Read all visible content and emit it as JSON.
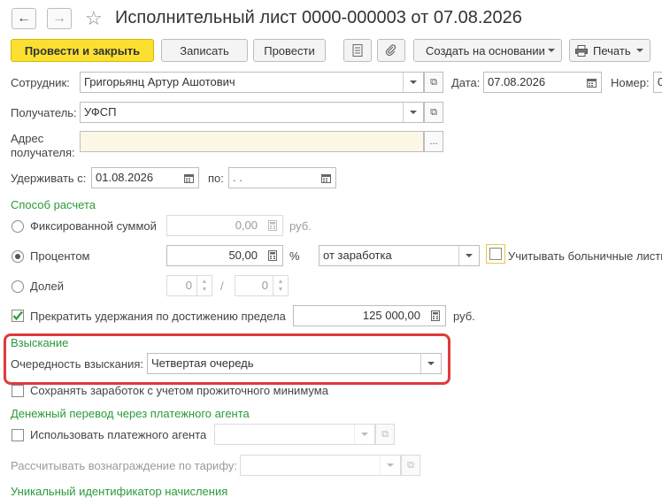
{
  "window": {
    "title": "Исполнительный лист 0000-000003 от 07.08.2026"
  },
  "toolbar": {
    "post_close": "Провести и закрыть",
    "save": "Записать",
    "post": "Провести",
    "create_based": "Создать на основании",
    "print": "Печать"
  },
  "header": {
    "employee_label": "Сотрудник:",
    "employee_value": "Григорьянц Артур Ашотович",
    "date_label": "Дата:",
    "date_value": "07.08.2026",
    "number_label": "Номер:",
    "number_value": "0",
    "recipient_label": "Получатель:",
    "recipient_value": "УФСП",
    "address_label_1": "Адрес",
    "address_label_2": "получателя:",
    "address_value": "",
    "hold_from_label": "Удерживать с:",
    "hold_from_value": "01.08.2026",
    "hold_to_label": "по:",
    "hold_to_value": " .  ."
  },
  "calc_method": {
    "section_title": "Способ расчета",
    "fixed_label": "Фиксированной суммой",
    "fixed_value": "0,00",
    "fixed_unit": "руб.",
    "percent_label": "Процентом",
    "percent_value": "50,00",
    "percent_unit": "%",
    "percent_base": "от заработка",
    "sick_label": "Учитывать больничные листы",
    "shares_label": "Долей",
    "shares_num": "0",
    "shares_sep": "/",
    "shares_den": "0",
    "limit_label": "Прекратить удержания по достижению предела",
    "limit_value": "125 000,00",
    "limit_unit": "руб."
  },
  "collection": {
    "section_title": "Взыскание",
    "priority_label": "Очередность взыскания:",
    "priority_value": "Четвертая очередь",
    "keep_min_label": "Сохранять заработок с учетом прожиточного минимума"
  },
  "payment_agent": {
    "section_title": "Денежный перевод через платежного агента",
    "use_agent_label": "Использовать платежного агента",
    "use_agent_value": "",
    "fee_label": "Рассчитывать вознаграждение по тарифу:",
    "fee_value": ""
  },
  "uid": {
    "section_title": "Уникальный идентификатор начисления"
  }
}
